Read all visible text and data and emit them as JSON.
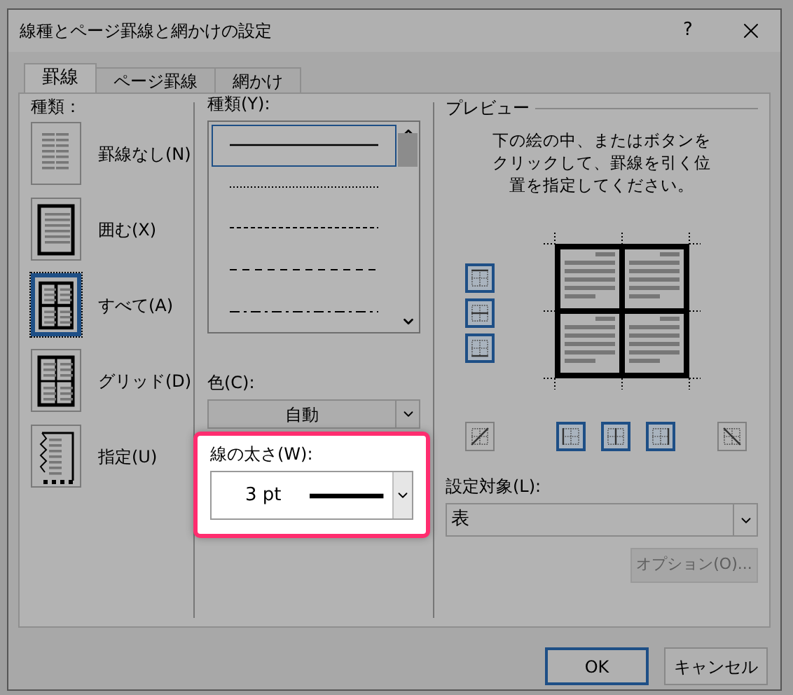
{
  "window": {
    "title": "線種とページ罫線と網かけの設定",
    "help": "?"
  },
  "tabs": [
    {
      "label": "罫線",
      "selected": true
    },
    {
      "label": "ページ罫線",
      "selected": false
    },
    {
      "label": "網かけ",
      "selected": false
    }
  ],
  "setting": {
    "label": "種類：",
    "items": [
      {
        "kind": "none",
        "label": "罫線なし(N)",
        "selected": false
      },
      {
        "kind": "box",
        "label": "囲む(X)",
        "selected": false
      },
      {
        "kind": "all",
        "label": "すべて(A)",
        "selected": true
      },
      {
        "kind": "grid",
        "label": "グリッド(D)",
        "selected": false
      },
      {
        "kind": "custom",
        "label": "指定(U)",
        "selected": false
      }
    ]
  },
  "style": {
    "label": "種類(Y):",
    "lines": [
      {
        "kind": "solid",
        "selected": true
      },
      {
        "kind": "dotted",
        "selected": false
      },
      {
        "kind": "dashed",
        "selected": false
      },
      {
        "kind": "long-dash",
        "selected": false
      },
      {
        "kind": "dash-dot",
        "selected": false
      }
    ]
  },
  "color": {
    "label": "色(C):",
    "value": "自動"
  },
  "width": {
    "label": "線の太さ(W):",
    "value": "3 pt",
    "highlighted": true
  },
  "preview": {
    "title": "プレビュー",
    "instructions": "下の絵の中、またはボタンをクリックして、罫線を引く位置を指定してください。",
    "side_buttons": [
      {
        "kind": "top",
        "selected": true
      },
      {
        "kind": "middle",
        "selected": true
      },
      {
        "kind": "bottom",
        "selected": true
      }
    ],
    "bottom_buttons": [
      {
        "kind": "diag-up",
        "selected": false
      },
      {
        "kind": "left",
        "selected": true
      },
      {
        "kind": "center",
        "selected": true
      },
      {
        "kind": "right",
        "selected": true
      },
      {
        "kind": "diag-down",
        "selected": false
      }
    ]
  },
  "apply_to": {
    "label": "設定対象(L):",
    "value": "表"
  },
  "options_button": {
    "label": "オプション(O)...",
    "disabled": true
  },
  "buttons": [
    {
      "label": "OK",
      "default": true
    },
    {
      "label": "キャンセル",
      "default": false
    }
  ]
}
